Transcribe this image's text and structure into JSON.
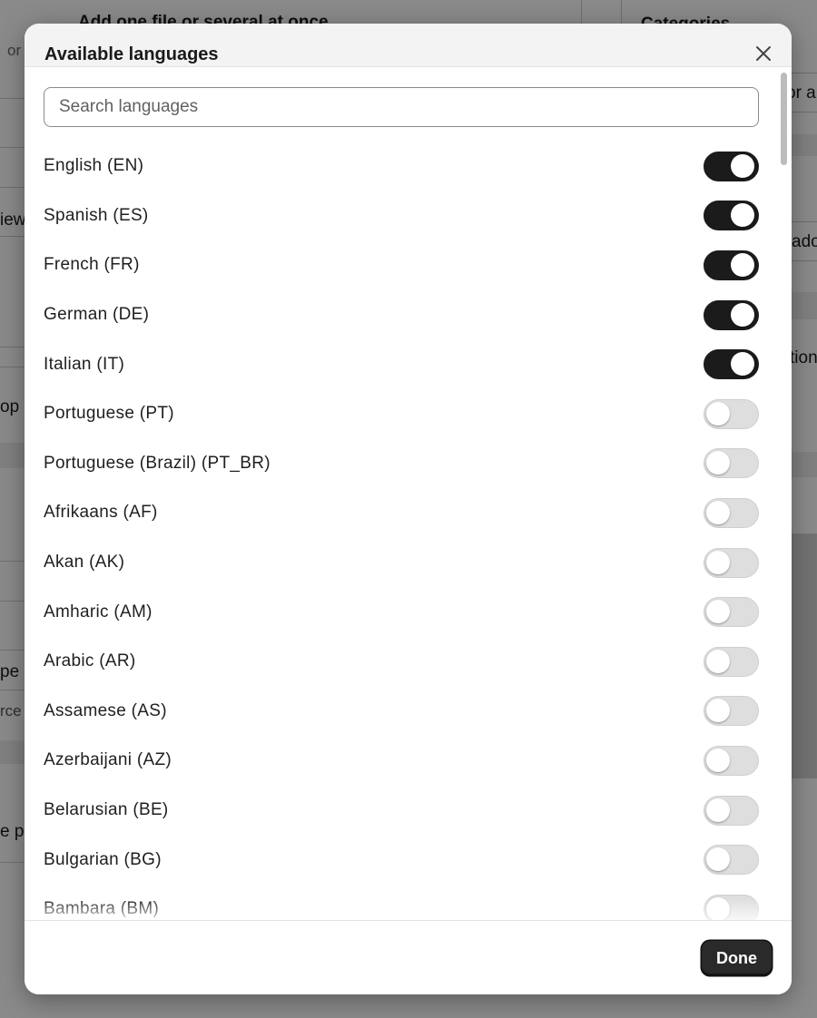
{
  "background": {
    "heading": "Add one file or several at once",
    "sidebar_title": "Categories",
    "fragments": [
      "or a",
      "or",
      "iew",
      "ado",
      "tion",
      "op o",
      "pe",
      "rce",
      "e pa"
    ]
  },
  "modal": {
    "title": "Available languages",
    "search": {
      "placeholder": "Search languages",
      "value": ""
    },
    "languages": [
      {
        "label": "English (EN)",
        "enabled": true
      },
      {
        "label": "Spanish (ES)",
        "enabled": true
      },
      {
        "label": "French (FR)",
        "enabled": true
      },
      {
        "label": "German (DE)",
        "enabled": true
      },
      {
        "label": "Italian (IT)",
        "enabled": true
      },
      {
        "label": "Portuguese (PT)",
        "enabled": false
      },
      {
        "label": "Portuguese (Brazil) (PT_BR)",
        "enabled": false
      },
      {
        "label": "Afrikaans (AF)",
        "enabled": false
      },
      {
        "label": "Akan (AK)",
        "enabled": false
      },
      {
        "label": "Amharic (AM)",
        "enabled": false
      },
      {
        "label": "Arabic (AR)",
        "enabled": false
      },
      {
        "label": "Assamese (AS)",
        "enabled": false
      },
      {
        "label": "Azerbaijani (AZ)",
        "enabled": false
      },
      {
        "label": "Belarusian (BE)",
        "enabled": false
      },
      {
        "label": "Bulgarian (BG)",
        "enabled": false
      },
      {
        "label": "Bambara (BM)",
        "enabled": false
      }
    ],
    "done_label": "Done"
  },
  "icons": {
    "close": "close-icon"
  },
  "colors": {
    "toggle_on": "#1b1b1b",
    "toggle_off": "#dedede",
    "done_button": "#2a2a2a"
  }
}
